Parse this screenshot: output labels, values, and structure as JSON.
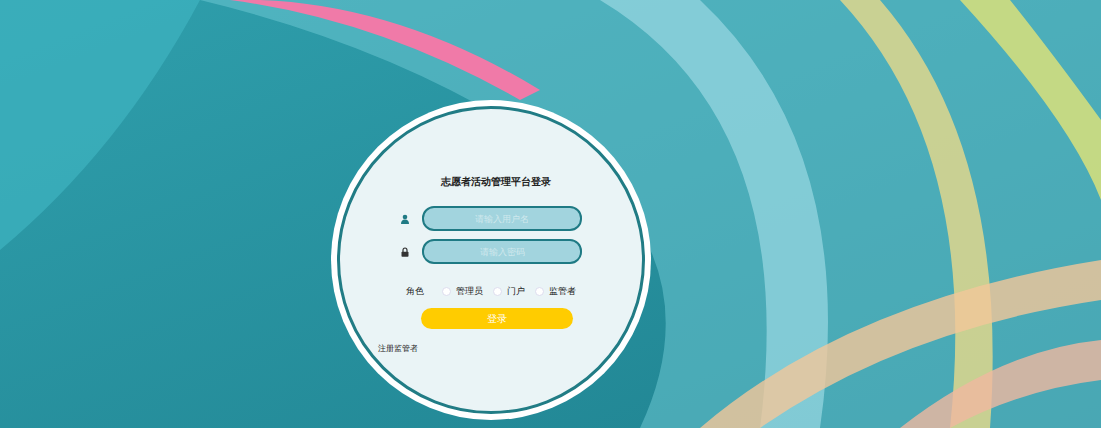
{
  "title": "志愿者活动管理平台登录",
  "fields": [
    {
      "kind": "user",
      "placeholder": "请输入用户名"
    },
    {
      "kind": "password",
      "placeholder": "请输入密码"
    }
  ],
  "role_label": "角色",
  "roles": [
    {
      "label": "管理员",
      "selected": false
    },
    {
      "label": "门户",
      "selected": false
    },
    {
      "label": "监管者",
      "selected": false
    }
  ],
  "login_button": "登录",
  "register_link": "注册监管者"
}
